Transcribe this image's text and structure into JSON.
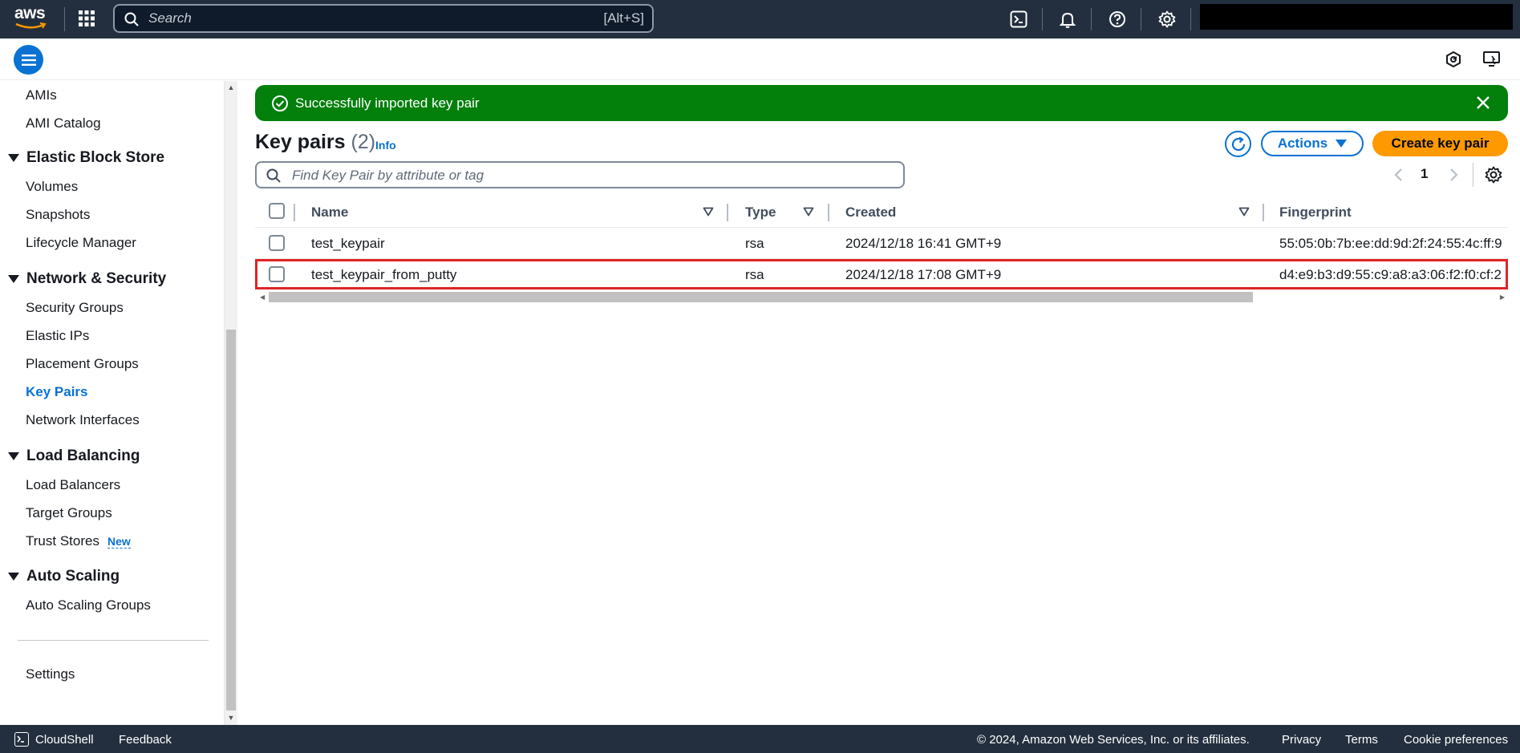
{
  "topnav": {
    "logo_text": "aws",
    "search_placeholder": "Search",
    "search_shortcut": "[Alt+S]",
    "icons": [
      "cloudshell-icon",
      "bell-icon",
      "help-icon",
      "gear-icon"
    ]
  },
  "sidebar": {
    "items_top": [
      "AMIs",
      "AMI Catalog"
    ],
    "sections": [
      {
        "title": "Elastic Block Store",
        "items": [
          "Volumes",
          "Snapshots",
          "Lifecycle Manager"
        ]
      },
      {
        "title": "Network & Security",
        "items": [
          "Security Groups",
          "Elastic IPs",
          "Placement Groups",
          "Key Pairs",
          "Network Interfaces"
        ]
      },
      {
        "title": "Load Balancing",
        "items": [
          "Load Balancers",
          "Target Groups",
          "Trust Stores"
        ]
      },
      {
        "title": "Auto Scaling",
        "items": [
          "Auto Scaling Groups"
        ]
      }
    ],
    "active_item": "Key Pairs",
    "new_badge": "New",
    "settings": "Settings"
  },
  "flash": {
    "message": "Successfully imported key pair"
  },
  "header": {
    "title": "Key pairs",
    "count": "(2)",
    "info": "Info",
    "actions_label": "Actions",
    "create_label": "Create key pair"
  },
  "filter": {
    "placeholder": "Find Key Pair by attribute or tag"
  },
  "pagination": {
    "current_page": "1"
  },
  "table": {
    "columns": [
      "Name",
      "Type",
      "Created",
      "Fingerprint"
    ],
    "rows": [
      {
        "name": "test_keypair",
        "type": "rsa",
        "created": "2024/12/18 16:41 GMT+9",
        "fingerprint": "55:05:0b:7b:ee:dd:9d:2f:24:55:4c:ff:9"
      },
      {
        "name": "test_keypair_from_putty",
        "type": "rsa",
        "created": "2024/12/18 17:08 GMT+9",
        "fingerprint": "d4:e9:b3:d9:55:c9:a8:a3:06:f2:f0:cf:2"
      }
    ]
  },
  "footer": {
    "cloudshell": "CloudShell",
    "feedback": "Feedback",
    "copyright": "© 2024, Amazon Web Services, Inc. or its affiliates.",
    "privacy": "Privacy",
    "terms": "Terms",
    "cookies": "Cookie preferences"
  },
  "colors": {
    "nav_bg": "#232f3e",
    "accent_blue": "#0972d3",
    "success_green": "#037f0c",
    "primary_orange": "#ff9900",
    "selection_red": "#e02424"
  }
}
